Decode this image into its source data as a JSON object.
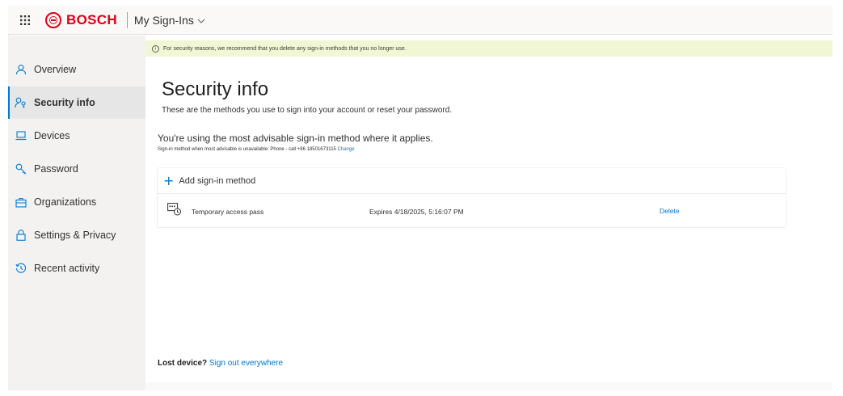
{
  "header": {
    "brand": "BOSCH",
    "app_title": "My Sign-Ins"
  },
  "banner": {
    "text": "For security reasons, we recommend that you delete any sign-in methods that you no longer use."
  },
  "sidebar": {
    "items": [
      {
        "label": "Overview",
        "icon": "person-icon"
      },
      {
        "label": "Security info",
        "icon": "security-info-icon",
        "active": true
      },
      {
        "label": "Devices",
        "icon": "laptop-icon"
      },
      {
        "label": "Password",
        "icon": "key-icon"
      },
      {
        "label": "Organizations",
        "icon": "briefcase-icon"
      },
      {
        "label": "Settings & Privacy",
        "icon": "lock-icon"
      },
      {
        "label": "Recent activity",
        "icon": "history-icon"
      }
    ]
  },
  "main": {
    "title": "Security info",
    "subtitle": "These are the methods you use to sign into your account or reset your password.",
    "advisable": "You're using the most advisable sign-in method where it applies.",
    "fallback_text": "Sign-in method when most advisable is unavailable: Phone - call +86 18501673115",
    "fallback_link": "Change",
    "add_method": "Add sign-in method",
    "methods": [
      {
        "name": "Temporary access pass",
        "expires": "Expires 4/18/2025, 5:16:07 PM",
        "action": "Delete"
      }
    ],
    "lost_device_label": "Lost device?",
    "lost_device_link": "Sign out everywhere"
  },
  "colors": {
    "brand_red": "#e20015",
    "accent_blue": "#0078d4",
    "banner_bg": "#f1f7d4",
    "sidebar_bg": "#f3f2f1"
  }
}
